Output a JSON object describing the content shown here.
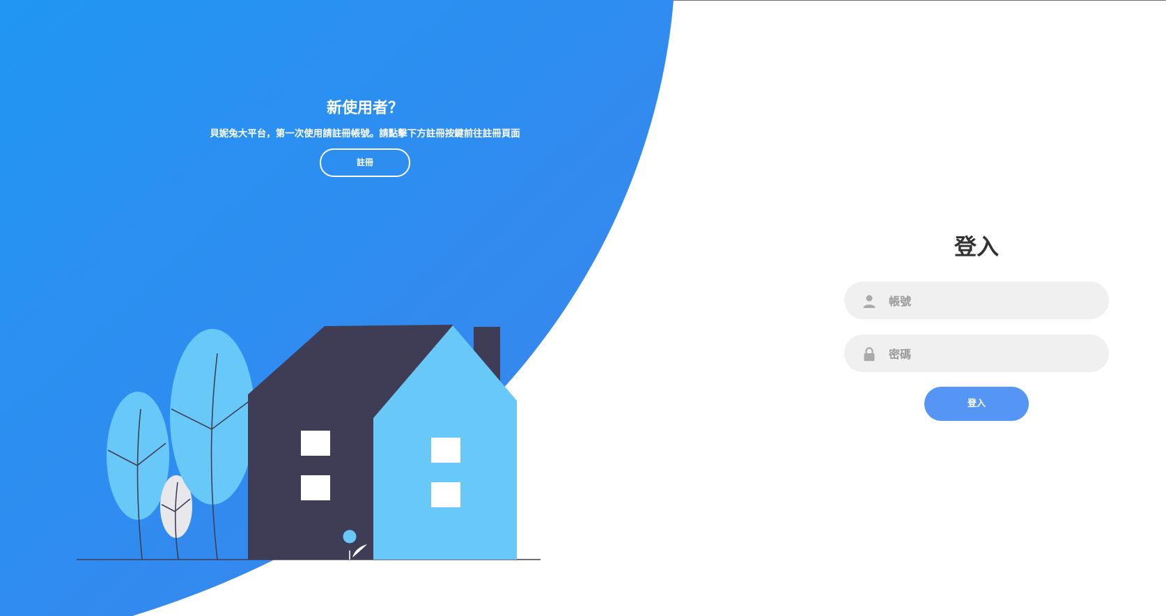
{
  "welcome": {
    "title": "新使用者？",
    "description": "貝妮兔大平台，第一次使用請註冊帳號。請點擊下方註冊按鍵前往註冊頁面",
    "register_label": "註冊"
  },
  "login": {
    "title": "登入",
    "username_placeholder": "帳號",
    "password_placeholder": "密碼",
    "submit_label": "登入"
  },
  "colors": {
    "panel_gradient_start": "#2196f3",
    "panel_gradient_end": "#3a84ee",
    "house_dark": "#3f3d56",
    "house_light": "#68c9f9",
    "input_background": "#f0f0f0",
    "login_button": "#5596f5"
  }
}
